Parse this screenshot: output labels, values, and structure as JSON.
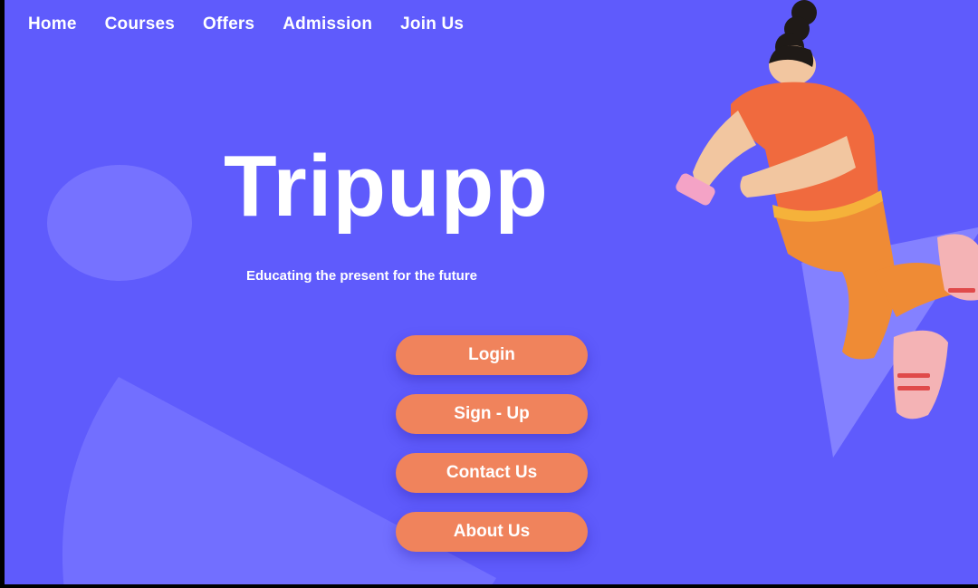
{
  "nav": {
    "items": [
      "Home",
      "Courses",
      "Offers",
      "Admission",
      "Join Us"
    ]
  },
  "hero": {
    "title": "Tripupp",
    "tagline": "Educating the present for the future"
  },
  "buttons": {
    "login": "Login",
    "signup": "Sign - Up",
    "contact": "Contact Us",
    "about": "About Us"
  },
  "colors": {
    "background": "#5f5bfc",
    "button": "#f0835c",
    "shape": "#7a77ff",
    "text": "#ffffff"
  },
  "illustration": {
    "icon": "person-with-phone-illustration"
  }
}
